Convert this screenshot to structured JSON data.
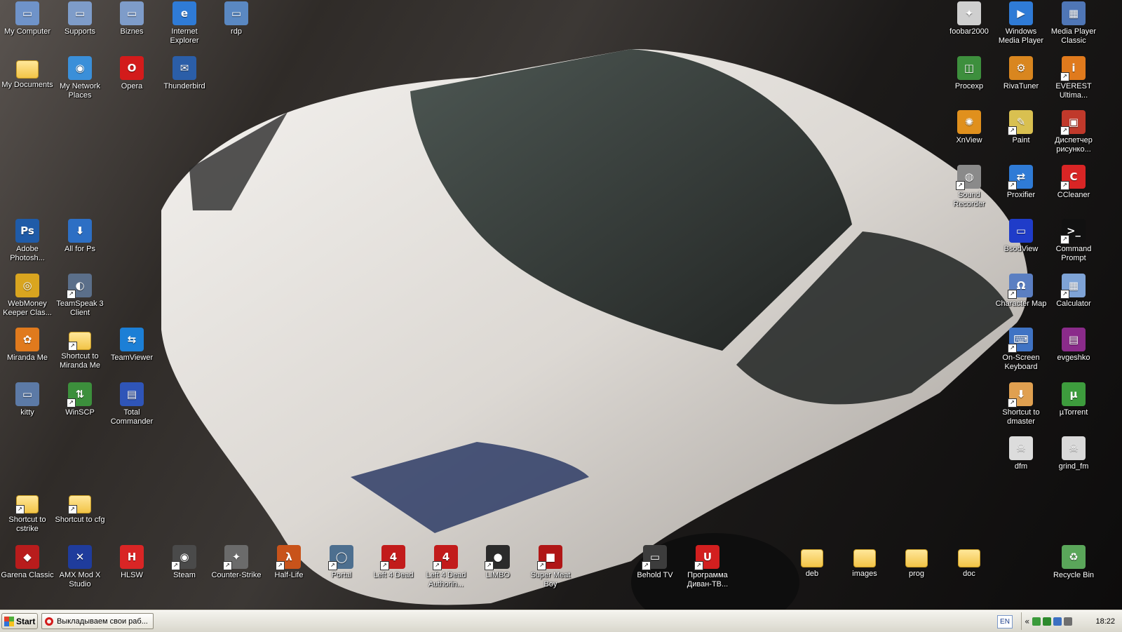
{
  "desktop_icons": [
    {
      "label": "My Computer",
      "icon": "computer-icon",
      "color": "#6f93c9",
      "glyph": "▭",
      "shortcut": false,
      "col": 0,
      "row": 0
    },
    {
      "label": "Supports",
      "icon": "network-computer-icon",
      "color": "#7e9cc9",
      "glyph": "▭",
      "shortcut": false,
      "col": 1,
      "row": 0
    },
    {
      "label": "Biznes",
      "icon": "network-computer-icon",
      "color": "#7e9cc9",
      "glyph": "▭",
      "shortcut": false,
      "col": 2,
      "row": 0
    },
    {
      "label": "Internet Explorer",
      "icon": "internet-explorer-icon",
      "color": "#2f7bd6",
      "glyph": "e",
      "shortcut": false,
      "col": 3,
      "row": 0
    },
    {
      "label": "rdp",
      "icon": "remote-desktop-icon",
      "color": "#5a88c2",
      "glyph": "▭",
      "shortcut": false,
      "col": 4,
      "row": 0
    },
    {
      "label": "My Documents",
      "icon": "documents-folder-icon",
      "color": "#f2c447",
      "glyph": "",
      "shortcut": false,
      "col": 0,
      "row": 1,
      "folder": true
    },
    {
      "label": "My Network Places",
      "icon": "network-places-icon",
      "color": "#3a8fd9",
      "glyph": "◉",
      "shortcut": false,
      "col": 1,
      "row": 1
    },
    {
      "label": "Opera",
      "icon": "opera-icon",
      "color": "#d31b1b",
      "glyph": "O",
      "shortcut": false,
      "col": 2,
      "row": 1
    },
    {
      "label": "Thunderbird",
      "icon": "thunderbird-icon",
      "color": "#2b5ea8",
      "glyph": "✉",
      "shortcut": false,
      "col": 3,
      "row": 1
    },
    {
      "label": "Adobe Photosh...",
      "icon": "photoshop-icon",
      "color": "#1f5ba8",
      "glyph": "Ps",
      "shortcut": false,
      "col": 0,
      "row": 4
    },
    {
      "label": "All for Ps",
      "icon": "photoshop-arrow-icon",
      "color": "#2d6fc4",
      "glyph": "⬇",
      "shortcut": false,
      "col": 1,
      "row": 4
    },
    {
      "label": "WebMoney Keeper Clas...",
      "icon": "webmoney-icon",
      "color": "#d9a51f",
      "glyph": "◎",
      "shortcut": false,
      "col": 0,
      "row": 5
    },
    {
      "label": "TeamSpeak 3 Client",
      "icon": "teamspeak-icon",
      "color": "#5b6f8a",
      "glyph": "◐",
      "shortcut": true,
      "col": 1,
      "row": 5
    },
    {
      "label": "Miranda Me",
      "icon": "miranda-icon",
      "color": "#e07a1d",
      "glyph": "✿",
      "shortcut": false,
      "col": 0,
      "row": 6
    },
    {
      "label": "Shortcut to Miranda Me",
      "icon": "folder-shortcut-icon",
      "color": "#f2c447",
      "glyph": "",
      "shortcut": true,
      "col": 1,
      "row": 6,
      "folder": true
    },
    {
      "label": "TeamViewer",
      "icon": "teamviewer-icon",
      "color": "#1c7fd6",
      "glyph": "⇆",
      "shortcut": false,
      "col": 2,
      "row": 6
    },
    {
      "label": "kitty",
      "icon": "kitty-icon",
      "color": "#5c7aa6",
      "glyph": "▭",
      "shortcut": false,
      "col": 0,
      "row": 7
    },
    {
      "label": "WinSCP",
      "icon": "winscp-icon",
      "color": "#3c8f3c",
      "glyph": "⇅",
      "shortcut": true,
      "col": 1,
      "row": 7
    },
    {
      "label": "Total Commander",
      "icon": "total-commander-icon",
      "color": "#2f55b8",
      "glyph": "▤",
      "shortcut": false,
      "col": 2,
      "row": 7
    },
    {
      "label": "Shortcut to cstrike",
      "icon": "folder-shortcut-icon",
      "color": "#f2c447",
      "glyph": "",
      "shortcut": true,
      "col": 0,
      "row": 9,
      "folder": true
    },
    {
      "label": "Shortcut to cfg",
      "icon": "folder-shortcut-icon",
      "color": "#f2c447",
      "glyph": "",
      "shortcut": true,
      "col": 1,
      "row": 9,
      "folder": true
    },
    {
      "label": "Garena Classic",
      "icon": "garena-icon",
      "color": "#b81c1c",
      "glyph": "◆",
      "shortcut": false,
      "col": 0,
      "row": 10
    },
    {
      "label": "AMX Mod X Studio",
      "icon": "amx-mod-icon",
      "color": "#1f3c9c",
      "glyph": "✕",
      "shortcut": false,
      "col": 1,
      "row": 10
    },
    {
      "label": "HLSW",
      "icon": "hlsw-icon",
      "color": "#d92525",
      "glyph": "H",
      "shortcut": false,
      "col": 2,
      "row": 10
    },
    {
      "label": "Steam",
      "icon": "steam-icon",
      "color": "#4a4a4a",
      "glyph": "◉",
      "shortcut": true,
      "col": 3,
      "row": 10
    },
    {
      "label": "Counter-Strike",
      "icon": "counter-strike-icon",
      "color": "#6b6b6b",
      "glyph": "✦",
      "shortcut": true,
      "col": 4,
      "row": 10
    },
    {
      "label": "Half-Life",
      "icon": "half-life-icon",
      "color": "#c8531a",
      "glyph": "λ",
      "shortcut": true,
      "col": 5,
      "row": 10
    },
    {
      "label": "Portal",
      "icon": "portal-icon",
      "color": "#4d6f8f",
      "glyph": "◯",
      "shortcut": true,
      "col": 6,
      "row": 10
    },
    {
      "label": "Left 4 Dead",
      "icon": "left4dead-icon",
      "color": "#c21b1b",
      "glyph": "4",
      "shortcut": true,
      "col": 7,
      "row": 10
    },
    {
      "label": "Left 4 Dead Authorin...",
      "icon": "left4dead-authoring-icon",
      "color": "#c21b1b",
      "glyph": "4",
      "shortcut": true,
      "col": 8,
      "row": 10
    },
    {
      "label": "LIMBO",
      "icon": "limbo-icon",
      "color": "#2b2b2b",
      "glyph": "●",
      "shortcut": true,
      "col": 9,
      "row": 10
    },
    {
      "label": "Super Meat Boy",
      "icon": "super-meat-boy-icon",
      "color": "#b01616",
      "glyph": "■",
      "shortcut": true,
      "col": 10,
      "row": 10
    },
    {
      "label": "Behold TV",
      "icon": "behold-tv-icon",
      "color": "#3c3c3c",
      "glyph": "▭",
      "shortcut": true,
      "col": 12,
      "row": 10
    },
    {
      "label": "Программа Диван-ТВ...",
      "icon": "divan-tv-icon",
      "color": "#d21f1f",
      "glyph": "U",
      "shortcut": true,
      "col": 13,
      "row": 10
    },
    {
      "label": "deb",
      "icon": "folder-icon",
      "color": "#f2c447",
      "glyph": "",
      "shortcut": false,
      "col": 15,
      "row": 10,
      "folder": true
    },
    {
      "label": "images",
      "icon": "folder-icon",
      "color": "#f2c447",
      "glyph": "",
      "shortcut": false,
      "col": 16,
      "row": 10,
      "folder": true
    },
    {
      "label": "prog",
      "icon": "folder-icon",
      "color": "#f2c447",
      "glyph": "",
      "shortcut": false,
      "col": 17,
      "row": 10,
      "folder": true
    },
    {
      "label": "doc",
      "icon": "folder-icon",
      "color": "#f2c447",
      "glyph": "",
      "shortcut": false,
      "col": 18,
      "row": 10,
      "folder": true
    },
    {
      "label": "Recycle Bin",
      "icon": "recycle-bin-icon",
      "color": "#5aa65a",
      "glyph": "♻",
      "shortcut": false,
      "col": 20,
      "row": 10
    },
    {
      "label": "foobar2000",
      "icon": "foobar-icon",
      "color": "#cfcfcf",
      "glyph": "✦",
      "shortcut": false,
      "col": 18,
      "row": 0
    },
    {
      "label": "Windows Media Player",
      "icon": "media-player-icon",
      "color": "#2f7bd6",
      "glyph": "▶",
      "shortcut": false,
      "col": 19,
      "row": 0
    },
    {
      "label": "Media Player Classic",
      "icon": "mpc-icon",
      "color": "#4f76b6",
      "glyph": "▦",
      "shortcut": false,
      "col": 20,
      "row": 0
    },
    {
      "label": "Procexp",
      "icon": "procexp-icon",
      "color": "#3d8f3d",
      "glyph": "◫",
      "shortcut": false,
      "col": 18,
      "row": 1
    },
    {
      "label": "RivaTuner",
      "icon": "rivatuner-icon",
      "color": "#d9861f",
      "glyph": "⚙",
      "shortcut": false,
      "col": 19,
      "row": 1
    },
    {
      "label": "EVEREST Ultima...",
      "icon": "everest-icon",
      "color": "#e07a1d",
      "glyph": "i",
      "shortcut": true,
      "col": 20,
      "row": 1
    },
    {
      "label": "XnView",
      "icon": "xnview-icon",
      "color": "#e0901d",
      "glyph": "✺",
      "shortcut": false,
      "col": 18,
      "row": 2
    },
    {
      "label": "Paint",
      "icon": "paint-icon",
      "color": "#d9c050",
      "glyph": "✎",
      "shortcut": true,
      "col": 19,
      "row": 2
    },
    {
      "label": "Диспетчер рисунко...",
      "icon": "picture-manager-icon",
      "color": "#c0392b",
      "glyph": "▣",
      "shortcut": true,
      "col": 20,
      "row": 2
    },
    {
      "label": "Sound Recorder",
      "icon": "sound-recorder-icon",
      "color": "#8a8a8a",
      "glyph": "◍",
      "shortcut": true,
      "col": 18,
      "row": 3
    },
    {
      "label": "Proxifier",
      "icon": "proxifier-icon",
      "color": "#2f7bd6",
      "glyph": "⇄",
      "shortcut": true,
      "col": 19,
      "row": 3
    },
    {
      "label": "CCleaner",
      "icon": "ccleaner-icon",
      "color": "#d92525",
      "glyph": "C",
      "shortcut": true,
      "col": 20,
      "row": 3
    },
    {
      "label": "BsodView",
      "icon": "bsodview-icon",
      "color": "#1f3cc9",
      "glyph": "▭",
      "shortcut": false,
      "col": 19,
      "row": 4
    },
    {
      "label": "Command Prompt",
      "icon": "command-prompt-icon",
      "color": "#111111",
      "glyph": ">_",
      "shortcut": true,
      "col": 20,
      "row": 4
    },
    {
      "label": "Character Map",
      "icon": "character-map-icon",
      "color": "#5b7fc2",
      "glyph": "Ω",
      "shortcut": true,
      "col": 19,
      "row": 5
    },
    {
      "label": "Calculator",
      "icon": "calculator-icon",
      "color": "#7ea3d6",
      "glyph": "▦",
      "shortcut": true,
      "col": 20,
      "row": 5
    },
    {
      "label": "On-Screen Keyboard",
      "icon": "on-screen-keyboard-icon",
      "color": "#3f73c4",
      "glyph": "⌨",
      "shortcut": true,
      "col": 19,
      "row": 6
    },
    {
      "label": "evgeshko",
      "icon": "winrar-icon",
      "color": "#8a2b8a",
      "glyph": "▤",
      "shortcut": false,
      "col": 20,
      "row": 6
    },
    {
      "label": "Shortcut to dmaster",
      "icon": "dmaster-icon",
      "color": "#e0a050",
      "glyph": "⬇",
      "shortcut": true,
      "col": 19,
      "row": 7
    },
    {
      "label": "µTorrent",
      "icon": "utorrent-icon",
      "color": "#3d9c3d",
      "glyph": "µ",
      "shortcut": false,
      "col": 20,
      "row": 7
    },
    {
      "label": "dfm",
      "icon": "dfm-document-icon",
      "color": "#dcdcdc",
      "glyph": "☠",
      "shortcut": false,
      "col": 19,
      "row": 8
    },
    {
      "label": "grind_fm",
      "icon": "grind-document-icon",
      "color": "#d9d9d9",
      "glyph": "☠",
      "shortcut": false,
      "col": 20,
      "row": 8
    }
  ],
  "taskbar": {
    "start_label": "Start",
    "task_label": "Выкладываем свои раб...",
    "language": "EN",
    "tray_chevron": "«",
    "clock": "18:22"
  },
  "colors": {
    "start_logo": [
      "#e4412c",
      "#4fae3a",
      "#2f73d9",
      "#f6c21f"
    ],
    "tray_icons": [
      "#3b9b3b",
      "#2d8a2d",
      "#3c70c2",
      "#6f6f6f"
    ]
  }
}
